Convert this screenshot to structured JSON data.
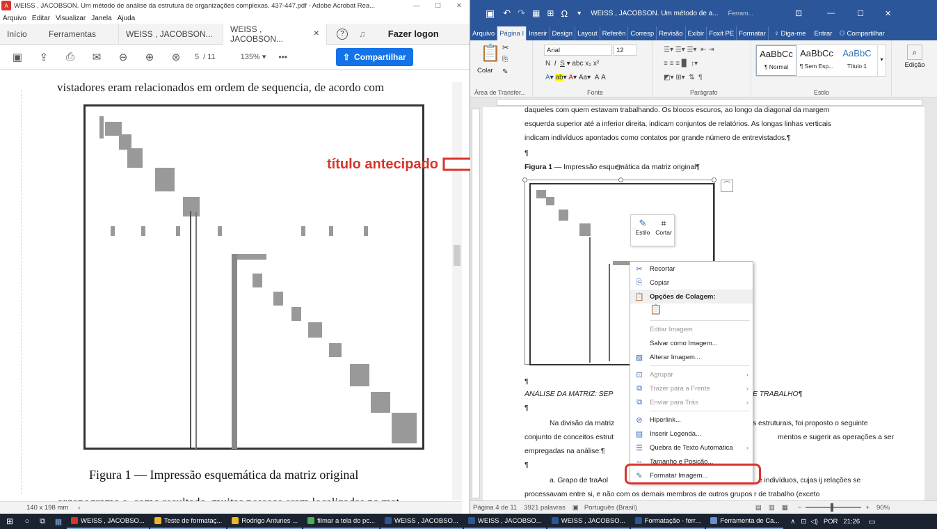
{
  "acrobat": {
    "title": "WEISS , JACOBSON. Um método de análise da estrutura de organizações complexas. 437-447.pdf - Adobe Acrobat Rea...",
    "menu": [
      "Arquivo",
      "Editar",
      "Visualizar",
      "Janela",
      "Ajuda"
    ],
    "tabs": [
      "Início",
      "Ferramentas",
      "WEISS , JACOBSON...",
      "WEISS , JACOBSON..."
    ],
    "login": "Fazer logon",
    "page_current": "5",
    "page_total": "/ 11",
    "zoom": "135%",
    "share": "Compartilhar",
    "doc_top_text": "vistadores eram relacionados em ordem de sequencia, de acordo com",
    "figure_caption": "Figura 1 — Impressão esquemática da matriz original",
    "doc_bottom_text": "organograma e, como resultado, muitas pessoas eram localizadas na mat",
    "page_size": "140 x 198 mm"
  },
  "annotation": "título antecipado",
  "word": {
    "title": "WEISS , JACOBSON. Um método de a...",
    "context_tab": "Ferram...",
    "tabs": [
      "Arquivo",
      "Página I",
      "Inserir",
      "Design",
      "Layout",
      "Referên",
      "Corresp",
      "Revisão",
      "Exibir",
      "Foxit PE",
      "Formatar"
    ],
    "tell_me": "Diga-me",
    "sign_in": "Entrar",
    "share": "Compartilhar",
    "ribbon": {
      "paste": "Colar",
      "font_name": "Arial",
      "font_size": "12",
      "styles": [
        {
          "sample": "AaBbCc",
          "name": "¶ Normal"
        },
        {
          "sample": "AaBbCc",
          "name": "¶ Sem Esp..."
        },
        {
          "sample": "AaBbC",
          "name": "Título 1"
        }
      ],
      "edit": "Edição",
      "groups": [
        "Área de Transfer...",
        "Fonte",
        "Parágrafo",
        "Estilo"
      ]
    },
    "doc": {
      "line1": "daqueles com quem estavam trabalhando. Os blocos escuros, ao longo da diagonal da margem",
      "line2": "esquerda superior até a inferior direita, indicam conjuntos de relatórios. As longas linhas verticais",
      "line3": "indicam indivíduos apontados como contatos por grande número de entrevistados.¶",
      "pilcrow": "¶",
      "caption_bold": "Figura 1",
      "caption_rest": " — Impressão esquemática da matriz original¶",
      "heading_start": "ANÁLISE DA MATRIZ: SEP",
      "heading_end": "E TRABALHO¶",
      "para1_start": "Na divisão da matriz",
      "para1_end": "s estruturais, foi proposto o seguinte",
      "para2_start": "conjunto de conceitos estrut",
      "para2_end": "mentos e sugerir as operações a ser",
      "para3": "empregadas na análise:¶",
      "para4_start": "a. Grapo de traAol",
      "para4_end": "e indivíduos, cujas ij relações se",
      "para5_start": "processavam entre si, e não com os demais membros de outros grupos r de trabalho (exceto"
    },
    "mini_toolbar": {
      "style": "Estilo",
      "crop": "Cortar"
    },
    "context_menu": {
      "items": [
        {
          "label": "Recortar",
          "icon": "scissors-icon",
          "disabled": false
        },
        {
          "label": "Copiar",
          "icon": "copy-icon",
          "disabled": false
        },
        {
          "label": "Opções de Colagem:",
          "icon": "paste-icon",
          "disabled": false,
          "header": true
        },
        {
          "label": "Editar Imagem",
          "icon": "",
          "disabled": true
        },
        {
          "label": "Salvar como Imagem...",
          "icon": "",
          "disabled": false
        },
        {
          "label": "Alterar Imagem...",
          "icon": "change-picture-icon",
          "disabled": false
        },
        {
          "label": "Agrupar",
          "icon": "group-icon",
          "disabled": true,
          "submenu": true
        },
        {
          "label": "Trazer para a Frente",
          "icon": "bring-front-icon",
          "disabled": true,
          "submenu": true
        },
        {
          "label": "Enviar para Trás",
          "icon": "send-back-icon",
          "disabled": true,
          "submenu": true
        },
        {
          "label": "Hiperlink...",
          "icon": "link-icon",
          "disabled": false
        },
        {
          "label": "Inserir Legenda...",
          "icon": "caption-icon",
          "disabled": false
        },
        {
          "label": "Quebra de Texto Automática",
          "icon": "wrap-text-icon",
          "disabled": false,
          "submenu": true
        },
        {
          "label": "Tamanho e Posição...",
          "icon": "size-position-icon",
          "disabled": false
        },
        {
          "label": "Formatar Imagem...",
          "icon": "format-picture-icon",
          "disabled": false
        }
      ]
    },
    "status": {
      "page": "Página 4 de 11",
      "words": "3921 palavras",
      "lang": "Português (Brasil)",
      "zoom": "90%"
    }
  },
  "taskbar": {
    "items": [
      {
        "label": "WEISS , JACOBSO...",
        "color": "#d9342b"
      },
      {
        "label": "Teste de formataç...",
        "color": "#f0b429"
      },
      {
        "label": "Rodrigo Antunes ...",
        "color": "#f0b429"
      },
      {
        "label": "filmar a tela do pc...",
        "color": "#4caf50"
      },
      {
        "label": "WEISS , JACOBSO...",
        "color": "#2b579a"
      },
      {
        "label": "WEISS , JACOBSO...",
        "color": "#2b579a"
      },
      {
        "label": "WEISS , JACOBSO...",
        "color": "#2b579a"
      },
      {
        "label": "Formatação - ferr...",
        "color": "#2b579a"
      },
      {
        "label": "Ferramenta de Ca...",
        "color": "#6a8fd0"
      }
    ],
    "lang": "POR",
    "time": "21:26"
  },
  "colors": {
    "word_blue": "#2b579a",
    "annotation_red": "#d9342b"
  }
}
